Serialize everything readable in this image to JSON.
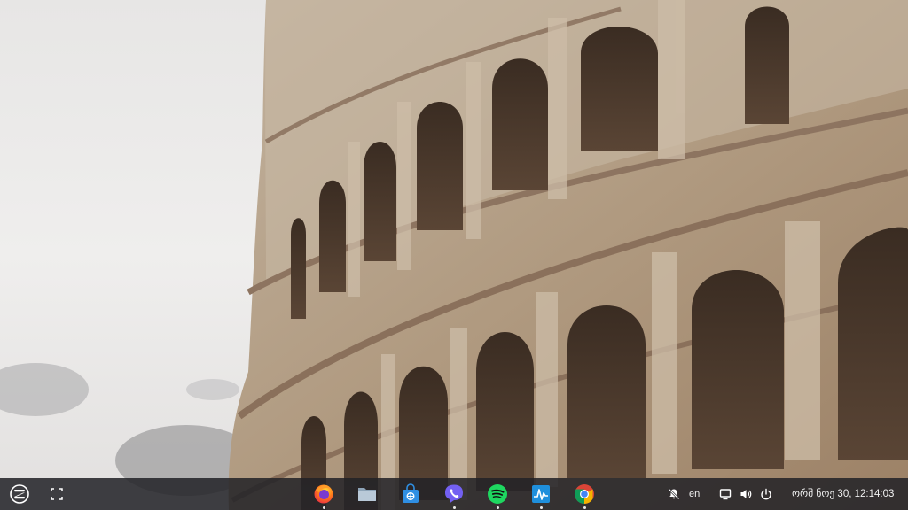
{
  "desktop": {
    "wallpaper": "colosseum-photo"
  },
  "taskbar": {
    "menu_icon": "zorin-logo-icon",
    "workspaces_icon": "window-overview-icon",
    "apps": [
      {
        "name": "firefox",
        "icon": "firefox-icon",
        "running": true
      },
      {
        "name": "files",
        "icon": "folder-icon",
        "running": false
      },
      {
        "name": "software",
        "icon": "software-store-icon",
        "running": false
      },
      {
        "name": "viber",
        "icon": "viber-icon",
        "running": true
      },
      {
        "name": "spotify",
        "icon": "spotify-icon",
        "running": true
      },
      {
        "name": "system-monitor",
        "icon": "system-monitor-icon",
        "running": true
      },
      {
        "name": "chrome",
        "icon": "chrome-icon",
        "running": true
      }
    ],
    "tray": {
      "notifications_icon": "notifications-muted-icon",
      "language": "en",
      "display_icon": "display-icon",
      "volume_icon": "volume-icon",
      "power_icon": "power-icon",
      "clock": "ორშ ნოე 30, 12:14:03"
    }
  },
  "colors": {
    "taskbar_bg": "#222226",
    "sky": "#ecebea",
    "stone": "#b8a48c"
  }
}
